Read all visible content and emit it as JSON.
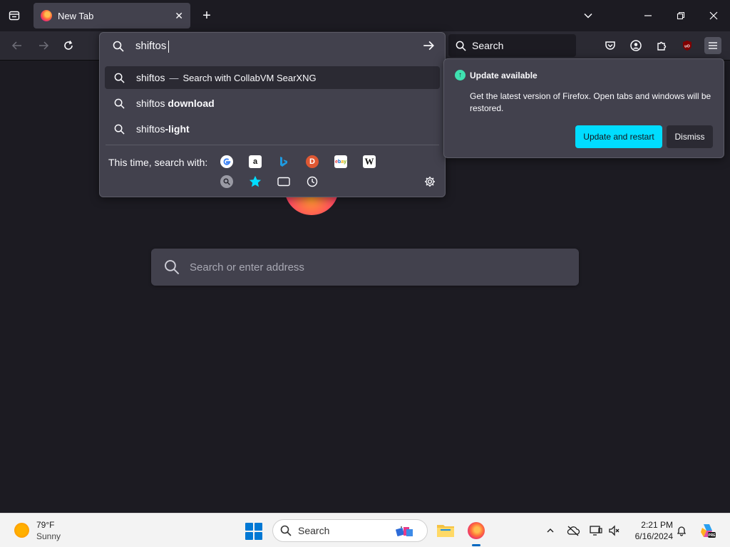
{
  "browser": {
    "tab": {
      "title": "New Tab"
    },
    "searchbar": {
      "placeholder": "Search"
    },
    "urlbar": {
      "value": "shiftos",
      "results": [
        {
          "prefix": "shiftos",
          "suffix": "",
          "separator": "—",
          "action": "Search with CollabVM SearXNG"
        },
        {
          "prefix": "shiftos ",
          "suffix": "download",
          "separator": "",
          "action": ""
        },
        {
          "prefix": "shiftos",
          "suffix": "-light",
          "separator": "",
          "action": ""
        }
      ],
      "oneoff_label": "This time, search with:",
      "engines": [
        "google-icon",
        "amazon-icon",
        "bing-icon",
        "duckduckgo-icon",
        "ebay-icon",
        "wikipedia-icon",
        "searxng-icon",
        "bookmarks-icon",
        "tabs-icon",
        "history-icon"
      ]
    },
    "update": {
      "title": "Update available",
      "body": "Get the latest version of Firefox. Open tabs and windows will be restored.",
      "primary": "Update and restart",
      "secondary": "Dismiss"
    },
    "page": {
      "search_placeholder": "Search or enter address"
    }
  },
  "taskbar": {
    "weather": {
      "temp": "79°F",
      "condition": "Sunny"
    },
    "search_label": "Search",
    "time": "2:21 PM",
    "date": "6/16/2024"
  },
  "colors": {
    "accent": "#00ddff",
    "update_green": "#3fe1b0"
  }
}
